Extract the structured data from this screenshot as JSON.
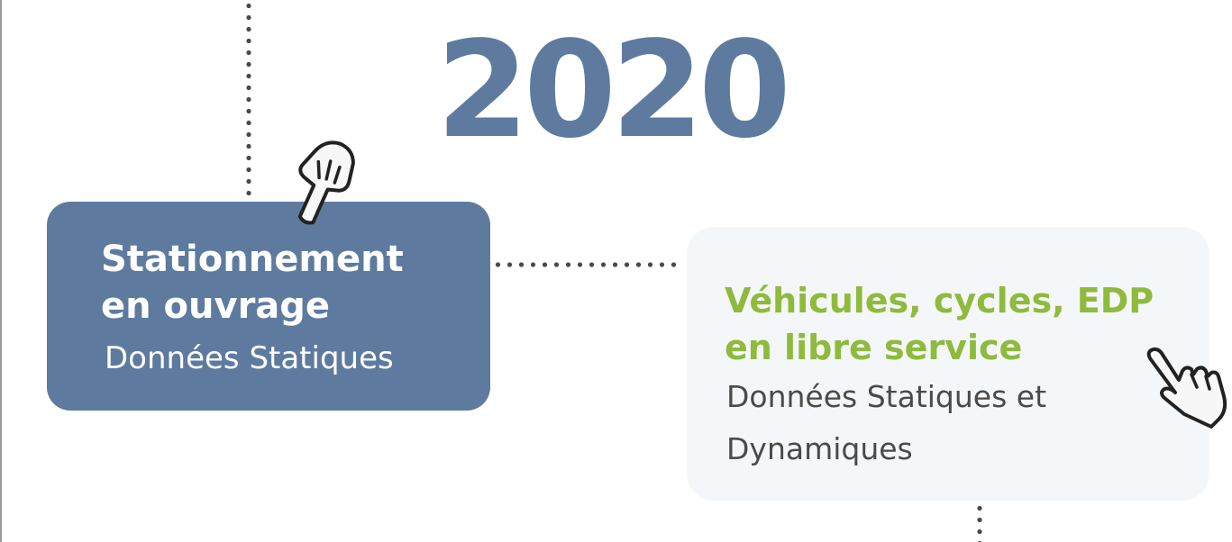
{
  "timeline": {
    "year": "2020"
  },
  "cards": {
    "left": {
      "title_line1": "Stationnement",
      "title_line2": "en ouvrage",
      "subtitle": "Données Statiques"
    },
    "right": {
      "title_line1": "Véhicules, cycles, EDP",
      "title_line2": "en libre service",
      "subtitle_line1": "Données Statiques et",
      "subtitle_line2": "Dynamiques"
    }
  },
  "colors": {
    "primary_blue": "#5e7b9f",
    "accent_green": "#8fba3d",
    "card_light_bg": "#f4f7f9",
    "dots": "#4a4a4a",
    "text_dark": "#4a4a4a"
  },
  "icons": {
    "left_card_pointer": "pointing-hand-icon",
    "right_card_pointer": "pointing-hand-icon"
  }
}
